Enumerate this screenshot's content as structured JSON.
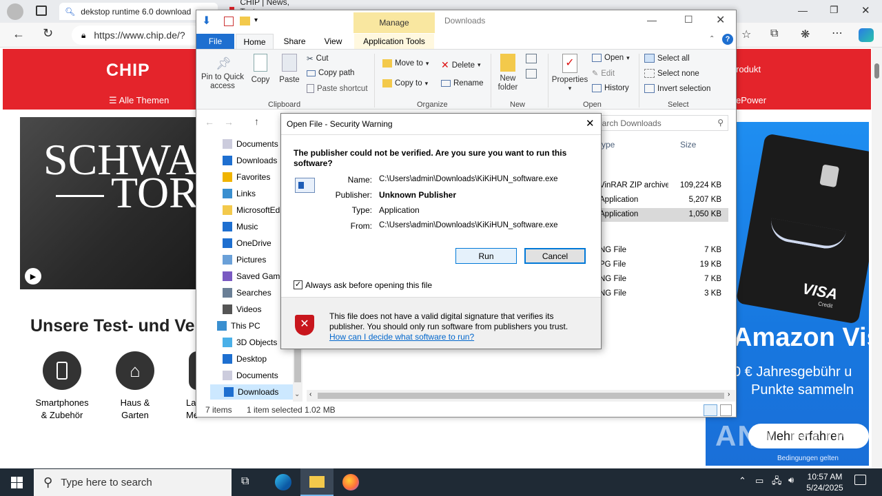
{
  "browser": {
    "tabs": [
      {
        "label": "dekstop runtime 6.0 download",
        "icon": "search-icon"
      },
      {
        "label": "CHIP | News, Tests, Downloads",
        "icon": "chip-favicon"
      }
    ],
    "address": "https://www.chip.de/?",
    "window_controls": {
      "minimize": "—",
      "restore": "❐",
      "close": "✕"
    }
  },
  "chip": {
    "logo": "CHIP",
    "nav_label": "Alle Themen",
    "header_right_1": "rodukt",
    "header_right_2": "ePower",
    "hero_line1": "SCHWA",
    "hero_line2": "TOR",
    "section_title": "Unsere Test- und Ver",
    "categories": [
      {
        "label1": "Smartphones",
        "label2": "& Zubehör"
      },
      {
        "label1": "Haus &",
        "label2": "Garten"
      },
      {
        "label1": "La",
        "label2": "Me"
      }
    ],
    "ad": {
      "brand": "VISA",
      "sub": "Credit",
      "headline": "Amazon Vis",
      "line1": "0 € Jahresgebühr u",
      "line2": "Punkte sammeln",
      "cta": "Mehr erfahren",
      "footnote": "Bedingungen gelten",
      "watermark": "ANY RUN"
    }
  },
  "explorer": {
    "title": "Downloads",
    "manage_tab": "Manage",
    "tabs": [
      "File",
      "Home",
      "Share",
      "View",
      "Application Tools"
    ],
    "clipboard": {
      "pin": "Pin to Quick access",
      "pin1": "Pin to Quick",
      "pin2": "access",
      "copy": "Copy",
      "paste": "Paste",
      "cut": "Cut",
      "copy_path": "Copy path",
      "paste_shortcut": "Paste shortcut",
      "group": "Clipboard"
    },
    "organize": {
      "move_to": "Move to",
      "copy_to": "Copy to",
      "delete": "Delete",
      "rename": "Rename",
      "group": "Organize"
    },
    "new": {
      "new_folder1": "New",
      "new_folder2": "folder",
      "group": "New"
    },
    "open": {
      "properties": "Properties",
      "open": "Open",
      "edit": "Edit",
      "history": "History",
      "group": "Open"
    },
    "select": {
      "select_all": "Select all",
      "select_none": "Select none",
      "invert": "Invert selection",
      "group": "Select"
    },
    "search_placeholder": "earch Downloads",
    "columns": {
      "type": "ype",
      "size": "Size"
    },
    "nav_items": [
      "Documents",
      "Downloads",
      "Favorites",
      "Links",
      "MicrosoftEd",
      "Music",
      "OneDrive",
      "Pictures",
      "Saved Game",
      "Searches",
      "Videos",
      "This PC",
      "3D Objects",
      "Desktop",
      "Documents",
      "Downloads"
    ],
    "files": [
      {
        "type": "VinRAR ZIP archive",
        "size": "109,224 KB"
      },
      {
        "type": "Application",
        "size": "5,207 KB"
      },
      {
        "type": "Application",
        "size": "1,050 KB"
      },
      {
        "type": "NG File",
        "size": "7 KB"
      },
      {
        "type": "PG File",
        "size": "19 KB"
      },
      {
        "type": "NG File",
        "size": "7 KB"
      },
      {
        "type": "NG File",
        "size": "3 KB"
      }
    ],
    "status": {
      "items": "7 items",
      "selected": "1 item selected",
      "size": "1.02 MB"
    }
  },
  "dialog": {
    "title": "Open File - Security Warning",
    "question": "The publisher could not be verified.  Are you sure you want to run this software?",
    "name_label": "Name:",
    "name": "C:\\Users\\admin\\Downloads\\KiKiHUN_software.exe",
    "publisher_label": "Publisher:",
    "publisher": "Unknown Publisher",
    "type_label": "Type:",
    "type": "Application",
    "from_label": "From:",
    "from": "C:\\Users\\admin\\Downloads\\KiKiHUN_software.exe",
    "run": "Run",
    "cancel": "Cancel",
    "always_ask": "Always ask before opening this file",
    "always_ask_checked": true,
    "warning": "This file does not have a valid digital signature that verifies its publisher.  You should only run software from publishers you trust.",
    "help_link": "How can I decide what software to run?"
  },
  "taskbar": {
    "search_placeholder": "Type here to search",
    "time": "10:57 AM",
    "date": "5/24/2025"
  }
}
